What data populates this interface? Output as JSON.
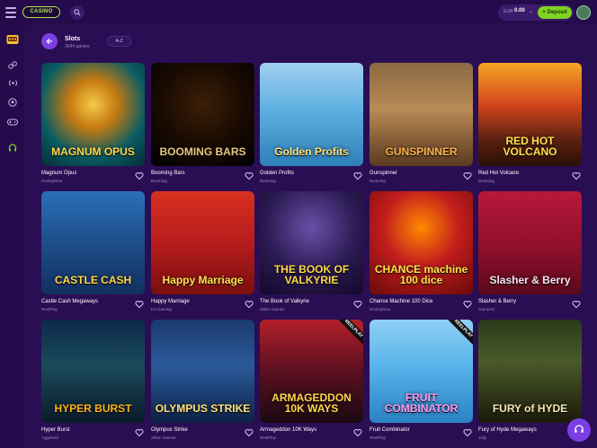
{
  "header": {
    "logo_text": "CASINO",
    "balance_currency": "EUR",
    "balance_amount": "0.00",
    "deposit_label": "Deposit"
  },
  "page": {
    "title": "Slots",
    "subtitle": "3544 games",
    "sort_label": "A-Z"
  },
  "games": [
    {
      "name": "Magnum Opus",
      "provider": "Endorphina",
      "art_title": "MAGNUM OPUS",
      "ribbon": ""
    },
    {
      "name": "Booming Bars",
      "provider": "Booming",
      "art_title": "BOOMING BARS",
      "ribbon": ""
    },
    {
      "name": "Golden Profits",
      "provider": "Booming",
      "art_title": "Golden Profits",
      "ribbon": ""
    },
    {
      "name": "Gunspinner",
      "provider": "Booming",
      "art_title": "GUNSPINNER",
      "ribbon": ""
    },
    {
      "name": "Red Hot Volcano",
      "provider": "Booming",
      "art_title": "RED HOT VOLCANO",
      "ribbon": ""
    },
    {
      "name": "Castle Cash Megaways",
      "provider": "ReelPlay",
      "art_title": "CASTLE CASH",
      "ribbon": ""
    },
    {
      "name": "Happy Marriage",
      "provider": "KA Gaming",
      "art_title": "Happy Marriage",
      "ribbon": ""
    },
    {
      "name": "The Book of Valkyrie",
      "provider": "Zillion Games",
      "art_title": "THE BOOK OF VALKYRIE",
      "ribbon": ""
    },
    {
      "name": "Chance Machine 100 Dice",
      "provider": "Endorphina",
      "art_title": "CHANCE machine 100 dice",
      "ribbon": ""
    },
    {
      "name": "Slasher & Berry",
      "provider": "GameArt",
      "art_title": "Slasher & Berry",
      "ribbon": ""
    },
    {
      "name": "Hyper Burst",
      "provider": "Yggdrasil",
      "art_title": "HYPER BURST",
      "ribbon": ""
    },
    {
      "name": "Olympus Strike",
      "provider": "Zillion Games",
      "art_title": "OLYMPUS STRIKE",
      "ribbon": ""
    },
    {
      "name": "Armageddon 10K Ways",
      "provider": "ReelPlay",
      "art_title": "ARMAGEDDON 10K WAYS",
      "ribbon": "REELPLAY"
    },
    {
      "name": "Fruit Combinator",
      "provider": "ReelPlay",
      "art_title": "FRUIT COMBINATOR",
      "ribbon": "REELPLAY"
    },
    {
      "name": "Fury of Hyde Megaways",
      "provider": "Jelly",
      "art_title": "FURY of HYDE",
      "ribbon": ""
    }
  ],
  "theme": {
    "background": "#2a0e54",
    "accent": "#7b3fe4",
    "deposit_green": "#7ed321"
  },
  "icons": [
    "menu-icon",
    "search-icon",
    "chevron-down-icon",
    "plus-icon",
    "back-arrow-icon",
    "heart-icon",
    "chat-icon"
  ]
}
